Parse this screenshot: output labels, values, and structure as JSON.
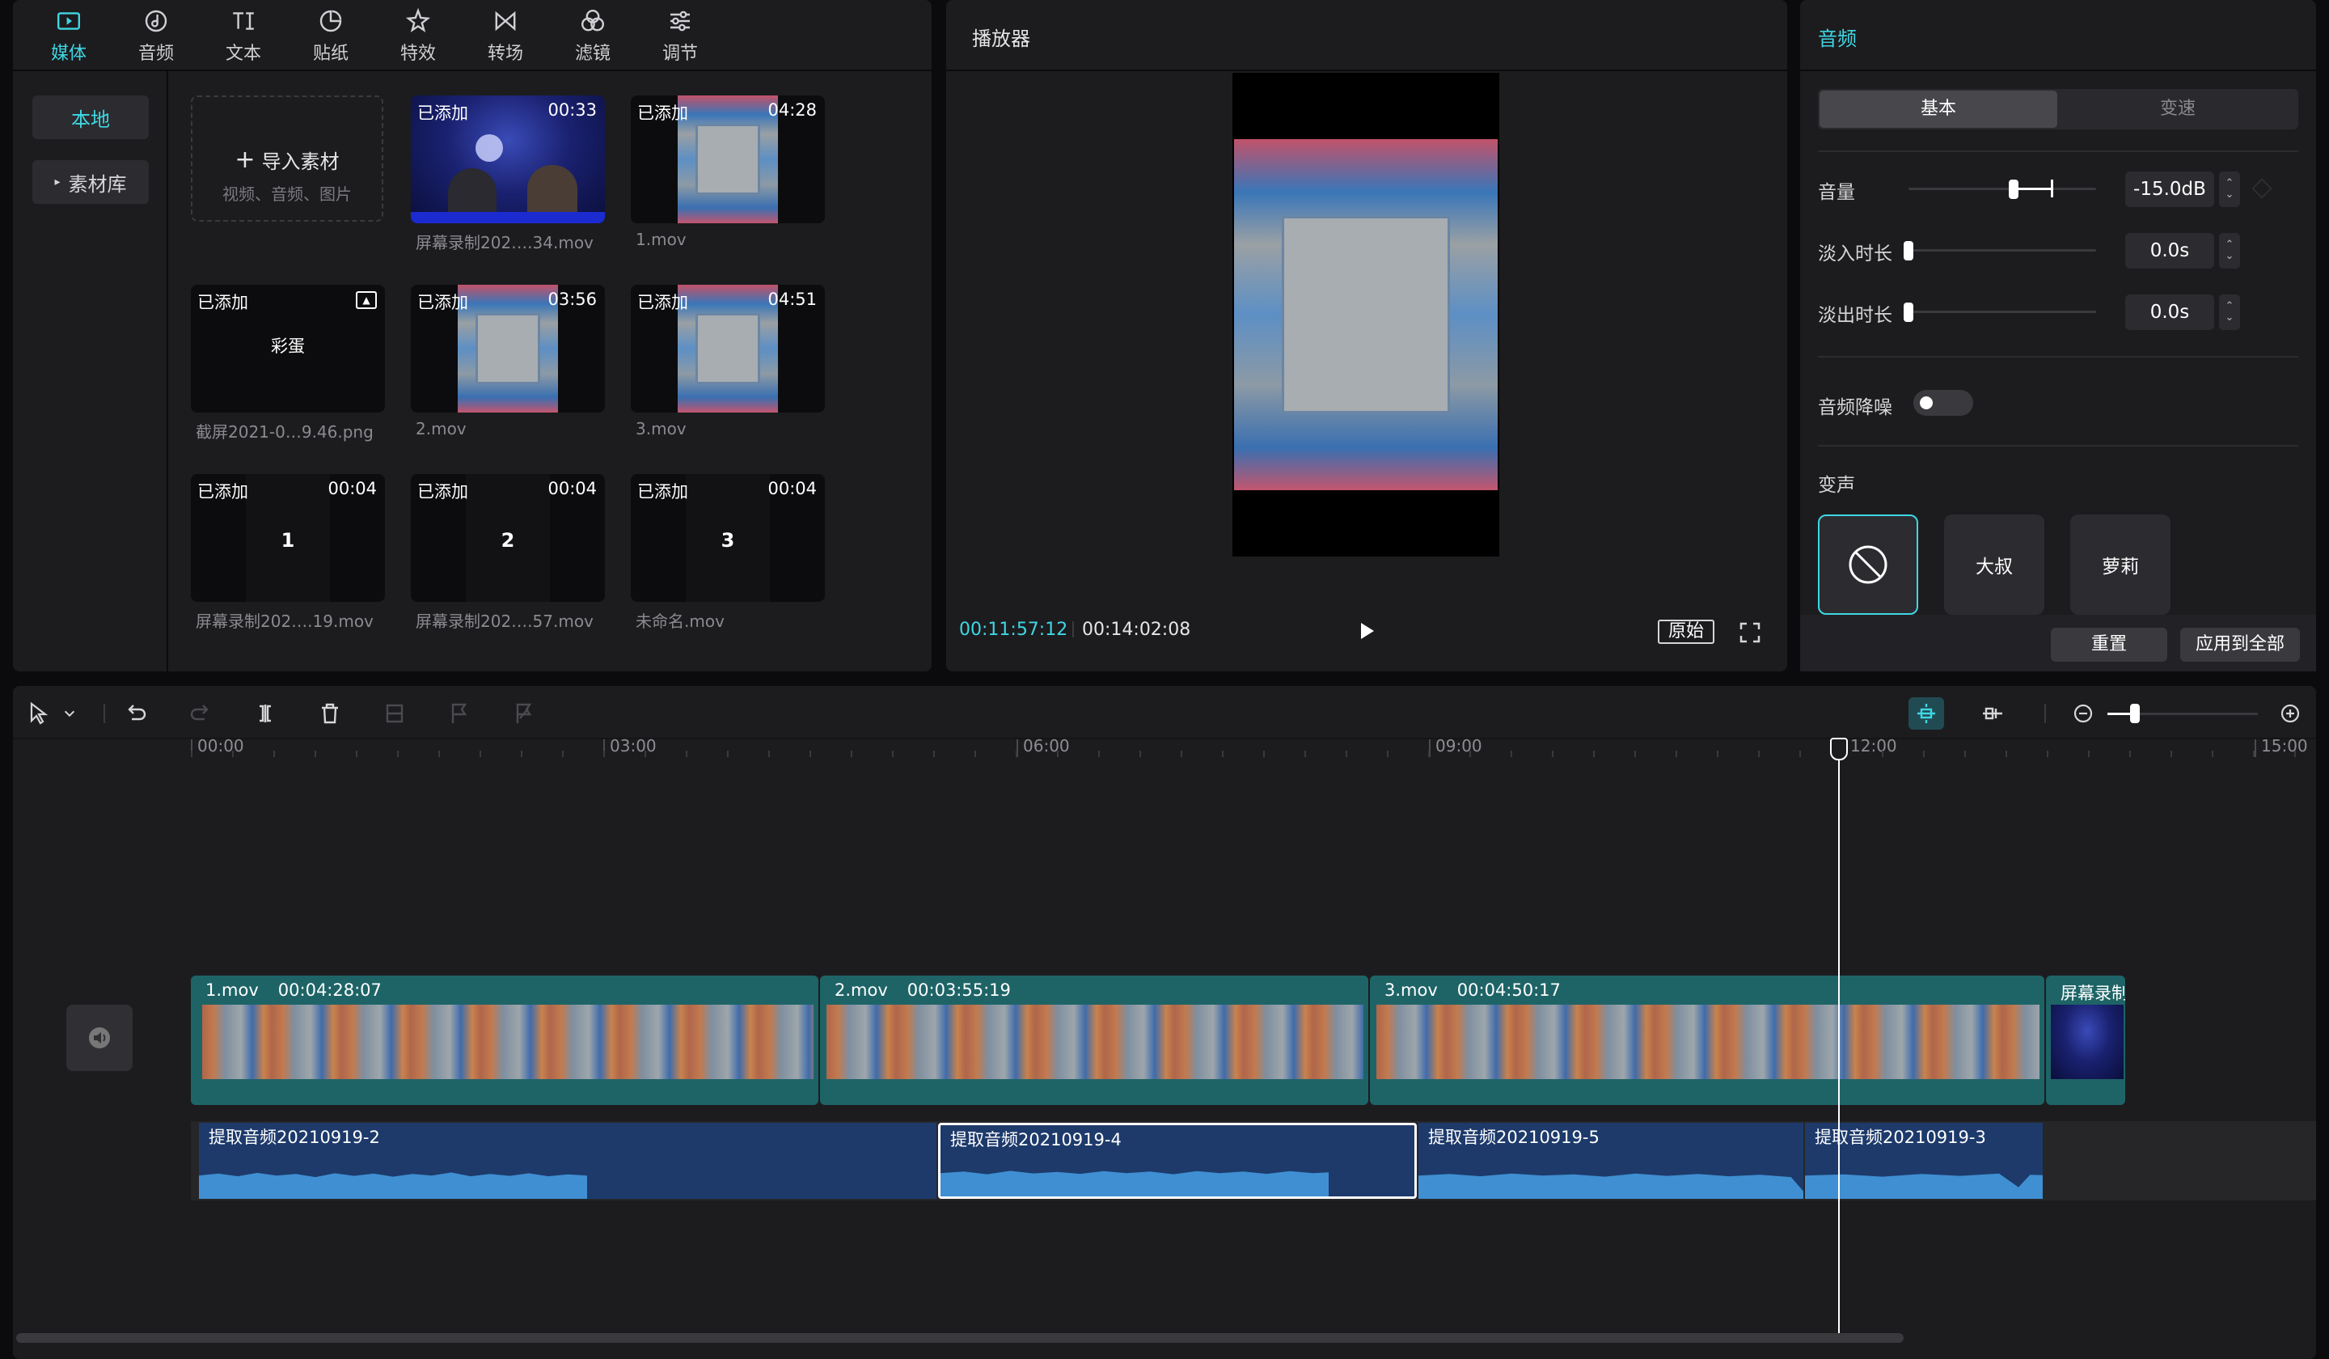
{
  "toolbar": {
    "tabs": [
      {
        "label": "媒体",
        "icon": "media-icon"
      },
      {
        "label": "音频",
        "icon": "audio-icon"
      },
      {
        "label": "文本",
        "icon": "text-icon"
      },
      {
        "label": "贴纸",
        "icon": "sticker-icon"
      },
      {
        "label": "特效",
        "icon": "effects-icon"
      },
      {
        "label": "转场",
        "icon": "transition-icon"
      },
      {
        "label": "滤镜",
        "icon": "filter-icon"
      },
      {
        "label": "调节",
        "icon": "adjust-icon"
      }
    ],
    "active_index": 0
  },
  "media_sidebar": {
    "local": "本地",
    "library": "素材库"
  },
  "import": {
    "label": "导入素材",
    "hint": "视频、音频、图片"
  },
  "media_items": [
    {
      "tag": "已添加",
      "duration": "00:33",
      "name": "屏幕录制202….34.mov",
      "thumb": "studio"
    },
    {
      "tag": "已添加",
      "duration": "04:28",
      "name": "1.mov",
      "thumb": "game"
    },
    {
      "tag": "已添加",
      "duration": "",
      "name": "截屏2021-0…9.46.png",
      "thumb": "image",
      "center_text": "彩蛋"
    },
    {
      "tag": "已添加",
      "duration": "03:56",
      "name": "2.mov",
      "thumb": "game"
    },
    {
      "tag": "已添加",
      "duration": "04:51",
      "name": "3.mov",
      "thumb": "game"
    },
    {
      "tag": "已添加",
      "duration": "00:04",
      "name": "屏幕录制202….19.mov",
      "thumb": "number",
      "center_text": "1"
    },
    {
      "tag": "已添加",
      "duration": "00:04",
      "name": "屏幕录制202….57.mov",
      "thumb": "number",
      "center_text": "2"
    },
    {
      "tag": "已添加",
      "duration": "00:04",
      "name": "未命名.mov",
      "thumb": "number",
      "center_text": "3"
    }
  ],
  "player": {
    "title": "播放器",
    "current_time": "00:11:57:12",
    "total_time": "00:14:02:08",
    "ratio_label": "原始"
  },
  "audio_panel": {
    "title": "音频",
    "tabs": [
      "基本",
      "变速"
    ],
    "volume": {
      "label": "音量",
      "value": "-15.0dB",
      "level": 0.56
    },
    "fade_in": {
      "label": "淡入时长",
      "value": "0.0s",
      "level": 0
    },
    "fade_out": {
      "label": "淡出时长",
      "value": "0.0s",
      "level": 0
    },
    "denoise": {
      "label": "音频降噪",
      "on": false
    },
    "voice_change": {
      "label": "变声",
      "options": [
        "none",
        "大叔",
        "萝莉"
      ]
    },
    "reset": "重置",
    "apply_all": "应用到全部"
  },
  "timeline": {
    "ruler": [
      "00:00",
      "03:00",
      "06:00",
      "09:00",
      "12:00",
      "15:00"
    ],
    "video_clips": [
      {
        "name": "1.mov",
        "duration": "00:04:28:07"
      },
      {
        "name": "2.mov",
        "duration": "00:03:55:19"
      },
      {
        "name": "3.mov",
        "duration": "00:04:50:17"
      },
      {
        "name": "屏幕录制",
        "duration": ""
      }
    ],
    "audio_clips": [
      {
        "name": "提取音频20210919-2"
      },
      {
        "name": "提取音频20210919-4",
        "selected": true
      },
      {
        "name": "提取音频20210919-5"
      },
      {
        "name": "提取音频20210919-3"
      }
    ],
    "playhead": "00:11:57:12"
  },
  "colors": {
    "accent": "#3fd7e3",
    "video_track": "#1e6467",
    "audio_track": "#1d3a6b"
  }
}
